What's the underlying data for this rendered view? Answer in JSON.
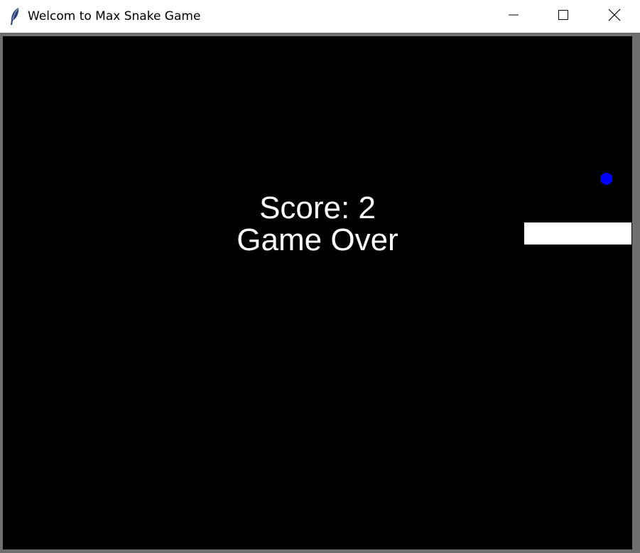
{
  "window": {
    "title": "Welcom to Max Snake Game",
    "icon": "tk-feather-icon",
    "controls": {
      "minimize_icon": "minimize-icon",
      "maximize_icon": "maximize-icon",
      "close_icon": "close-icon"
    }
  },
  "game": {
    "background_color": "#000000",
    "food_color": "#0000ff",
    "snake_color": "#ffffff",
    "score_text": "Score: 2",
    "status_text": "Game Over",
    "score": 2
  }
}
